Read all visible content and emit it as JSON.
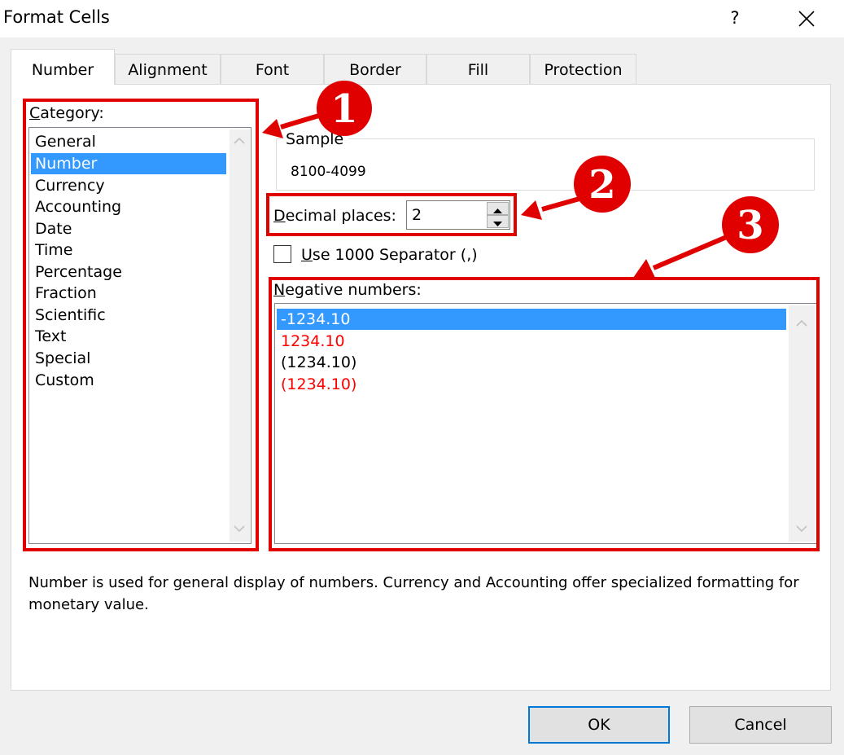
{
  "window": {
    "title": "Format Cells",
    "help_label": "?",
    "close_icon": "close-icon"
  },
  "tabs": [
    {
      "label": "Number",
      "active": true
    },
    {
      "label": "Alignment",
      "active": false
    },
    {
      "label": "Font",
      "active": false
    },
    {
      "label": "Border",
      "active": false
    },
    {
      "label": "Fill",
      "active": false
    },
    {
      "label": "Protection",
      "active": false
    }
  ],
  "category": {
    "label_first": "C",
    "label_rest": "ategory:",
    "items": [
      "General",
      "Number",
      "Currency",
      "Accounting",
      "Date",
      "Time",
      "Percentage",
      "Fraction",
      "Scientific",
      "Text",
      "Special",
      "Custom"
    ],
    "selected": "Number"
  },
  "sample": {
    "label": "Sample",
    "value": "8100-4099"
  },
  "decimal_places": {
    "label_first": "D",
    "label_rest": "ecimal places:",
    "value": "2"
  },
  "separator": {
    "label_first": "U",
    "label_rest": "se 1000 Separator (,)",
    "checked": false
  },
  "negative_numbers": {
    "label_first": "N",
    "label_rest": "egative numbers:",
    "items": [
      {
        "text": "-1234.10",
        "color": "#ffffff",
        "selected": true
      },
      {
        "text": "1234.10",
        "color": "#ff0000",
        "selected": false
      },
      {
        "text": "(1234.10)",
        "color": "#000000",
        "selected": false
      },
      {
        "text": "(1234.10)",
        "color": "#ff0000",
        "selected": false
      }
    ]
  },
  "description": "Number is used for general display of numbers.  Currency and Accounting offer specialized formatting for monetary value.",
  "buttons": {
    "ok": "OK",
    "cancel": "Cancel"
  },
  "annotations": {
    "badge_1": "1",
    "badge_2": "2",
    "badge_3": "3",
    "color": "#e00000"
  },
  "colors": {
    "selection": "#3399ff",
    "annotation_red": "#e00000",
    "default_button_border": "#0078d7"
  }
}
